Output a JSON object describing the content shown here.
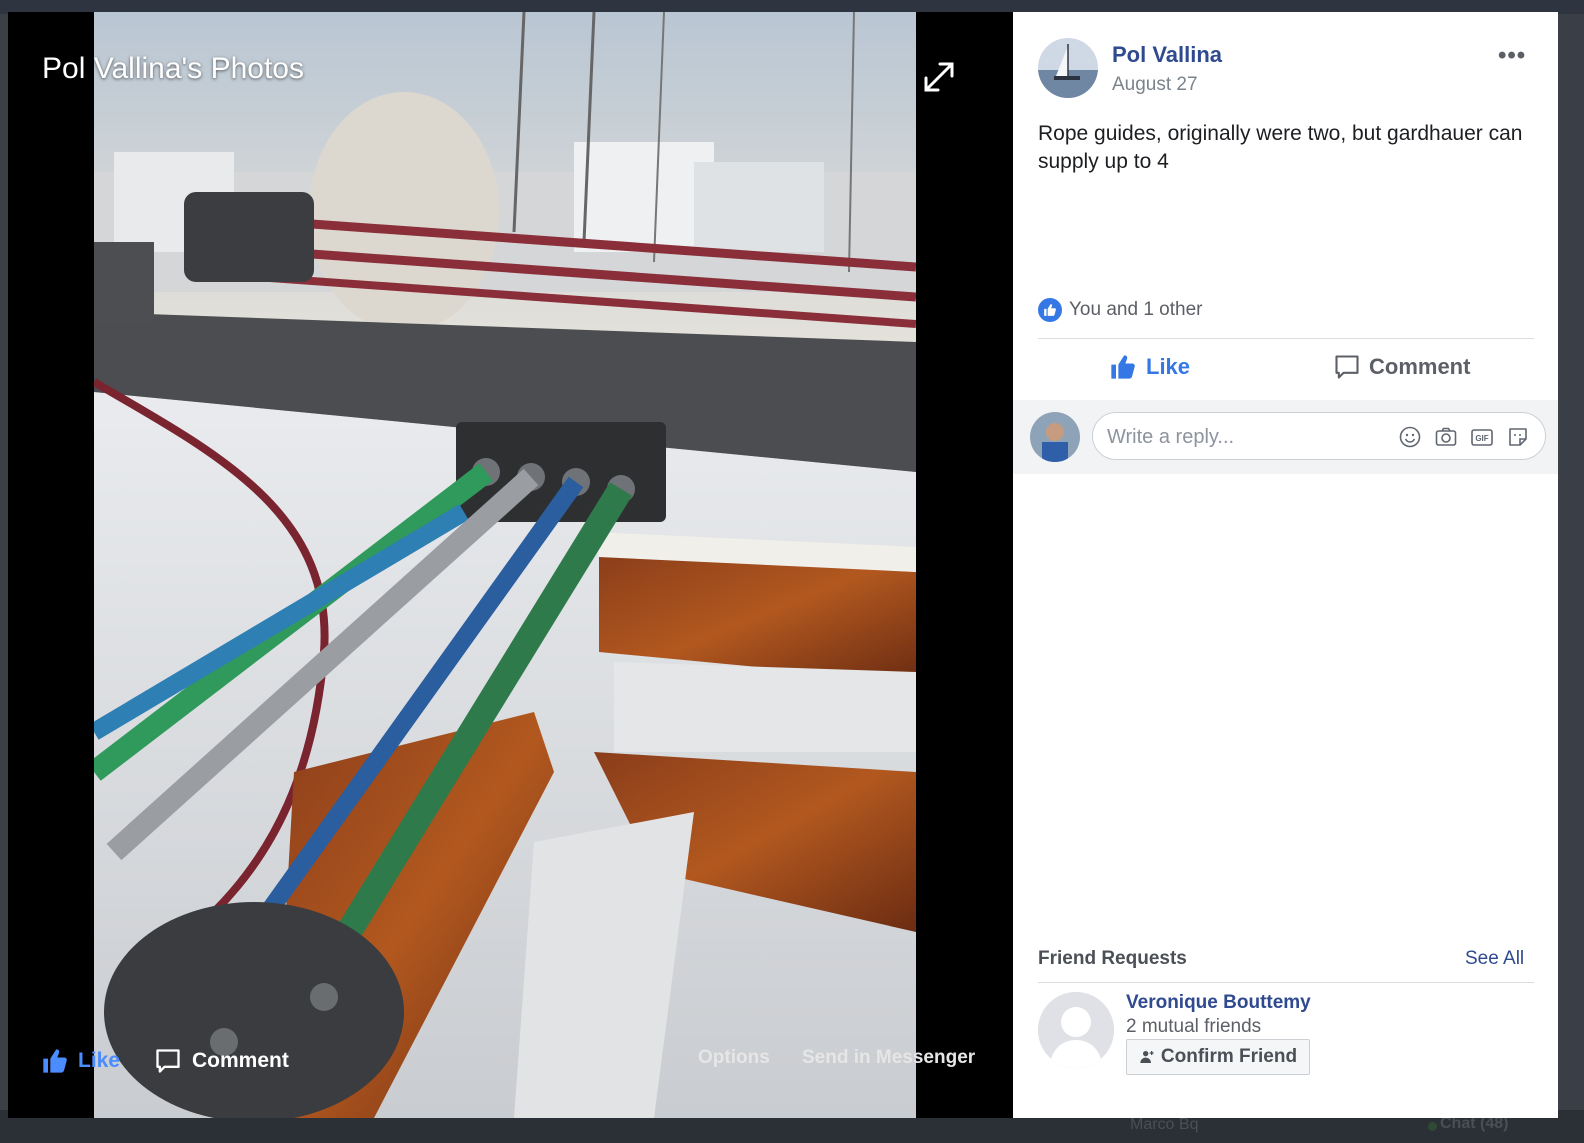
{
  "viewer": {
    "title": "Pol Vallina's Photos",
    "like_label": "Like",
    "comment_label": "Comment",
    "options_label": "Options",
    "send_label": "Send in Messenger"
  },
  "post": {
    "author": "Pol Vallina",
    "date": "August 27",
    "more_label": "•••",
    "text": "Rope guides, originally were two, but gardhauer can supply up to 4",
    "reactions": "You and 1 other",
    "like_label": "Like",
    "comment_label": "Comment",
    "reply_placeholder": "Write a reply..."
  },
  "friend_requests": {
    "title": "Friend Requests",
    "see_all": "See All",
    "items": [
      {
        "name": "Veronique Bouttemy",
        "mutual": "2 mutual friends",
        "confirm_label": "Confirm Friend"
      }
    ]
  },
  "background": {
    "chat_label": "Chat (48)",
    "bottom_name": "Marco Bq"
  },
  "colors": {
    "link_blue": "#2f4a8f",
    "like_blue": "#3578e5",
    "viewer_bg": "#000000",
    "panel_bg": "#ffffff"
  },
  "icons": [
    "expand-icon",
    "thumbs-up-icon",
    "comment-bubble-icon",
    "more-dots-icon",
    "emoji-icon",
    "camera-icon",
    "gif-icon",
    "sticker-icon",
    "add-friend-icon"
  ]
}
